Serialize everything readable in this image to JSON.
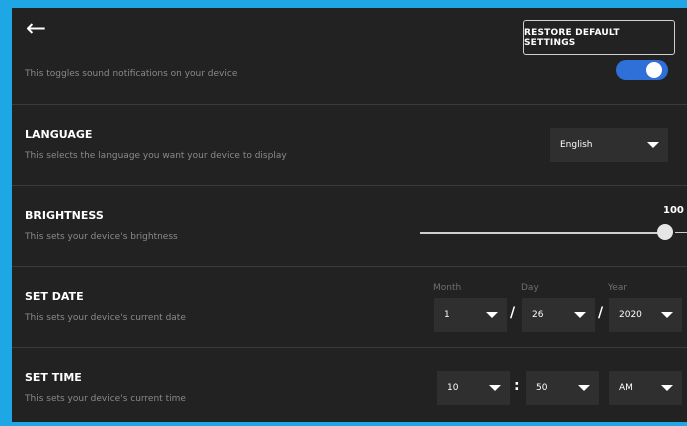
{
  "header": {
    "back_icon": "arrow-left-icon",
    "restore_label": "RESTORE DEFAULT SETTINGS"
  },
  "sound": {
    "description": "This toggles sound notifications on your device",
    "enabled": true
  },
  "language": {
    "title": "LANGUAGE",
    "description": "This selects the language you want your device to display",
    "selected": "English"
  },
  "brightness": {
    "title": "BRIGHTNESS",
    "description": "This sets your device's brightness",
    "value": "100",
    "level": 100
  },
  "date": {
    "title": "SET DATE",
    "description": "This sets your device's current date",
    "month_label": "Month",
    "day_label": "Day",
    "year_label": "Year",
    "month": "1",
    "day": "26",
    "year": "2020",
    "separator": "/"
  },
  "time": {
    "title": "SET TIME",
    "description": "This sets your device's current time",
    "hour": "10",
    "minute": "50",
    "period": "AM",
    "separator": ":"
  },
  "colors": {
    "frame": "#1ea7e4",
    "background": "#222222",
    "toggle_on": "#2e6fd8",
    "select_bg": "#2f2f2f"
  }
}
